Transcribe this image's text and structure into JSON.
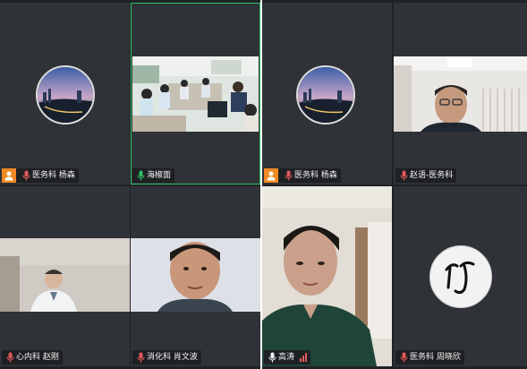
{
  "colors": {
    "background": "#1f2226",
    "tile": "#2f3236",
    "active_border": "#2fc26a",
    "host_badge": "#f08a24",
    "mic_on": "#2fc26a",
    "mic_muted": "#e35a5a"
  },
  "left_panel": {
    "tiles": [
      {
        "name": "医务科 杨森",
        "host": true,
        "mic": "muted",
        "content": "avatar"
      },
      {
        "name": "海椒面",
        "host": false,
        "mic": "on",
        "content": "meeting-room-video",
        "active": true
      },
      {
        "name": "心内科 赵刚",
        "host": false,
        "mic": "muted",
        "content": "doctor-video"
      },
      {
        "name": "消化科 肖文波",
        "host": false,
        "mic": "muted",
        "content": "man-video"
      }
    ]
  },
  "right_panel": {
    "tiles": [
      {
        "name": "医务科 杨森",
        "host": true,
        "mic": "muted",
        "content": "avatar"
      },
      {
        "name": "赵语-医务科",
        "host": false,
        "mic": "muted",
        "content": "man-glasses-video"
      },
      {
        "name": "高涛",
        "host": false,
        "mic": "on",
        "content": "man-video-large",
        "signal": true
      },
      {
        "name": "医务科 周晓欣",
        "host": false,
        "mic": "muted",
        "content": "calligraphy-logo"
      }
    ]
  }
}
